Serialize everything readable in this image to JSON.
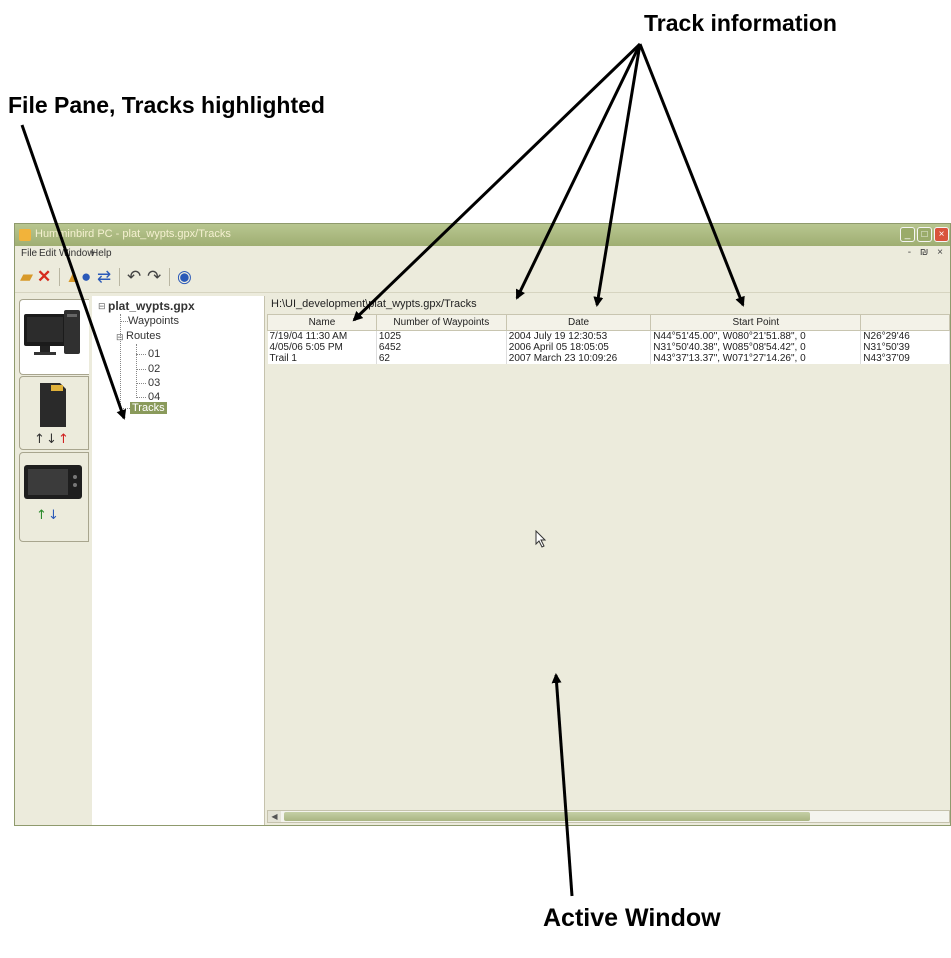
{
  "callouts": {
    "track_information": "Track information",
    "file_pane": "File Pane, Tracks highlighted",
    "active_window": "Active Window"
  },
  "window": {
    "title": "Humminbird PC - plat_wypts.gpx/Tracks",
    "menu": [
      "File",
      "Edit",
      "Window",
      "Help"
    ],
    "mdi_controls": "- ₪ ×"
  },
  "toolbar": {
    "icons": [
      "open-icon",
      "delete-icon",
      "upload-icon",
      "globe-icon",
      "transfer-icon",
      "undo-icon",
      "redo-icon",
      "help-icon"
    ]
  },
  "device_tabs": [
    "computer-tab",
    "sd-card-tab",
    "fishfinder-tab"
  ],
  "tree": {
    "root": "plat_wypts.gpx",
    "waypoints": "Waypoints",
    "routes": "Routes",
    "route_items": [
      "01",
      "02",
      "03",
      "04"
    ],
    "tracks": "Tracks"
  },
  "content": {
    "path": "H:\\UI_development\\plat_wypts.gpx/Tracks",
    "columns": [
      "Name",
      "Number of Waypoints",
      "Date",
      "Start Point",
      ""
    ],
    "rows": [
      [
        "7/19/04 11:30 AM",
        "1025",
        "2004 July 19 12:30:53",
        "N44°51'45.00\", W080°21'51.88\", 0",
        "N26°29'46"
      ],
      [
        "4/05/06 5:05 PM",
        "6452",
        "2006 April 05 18:05:05",
        "N31°50'40.38\", W085°08'54.42\", 0",
        "N31°50'39"
      ],
      [
        "Trail 1",
        "62",
        "2007 March 23 10:09:26",
        "N43°37'13.37\", W071°27'14.26\", 0",
        "N43°37'09"
      ]
    ]
  },
  "colors": {
    "titlebar": "#a9b77d",
    "highlight": "#8a9a5b",
    "content_bg": "#ecebdc"
  }
}
